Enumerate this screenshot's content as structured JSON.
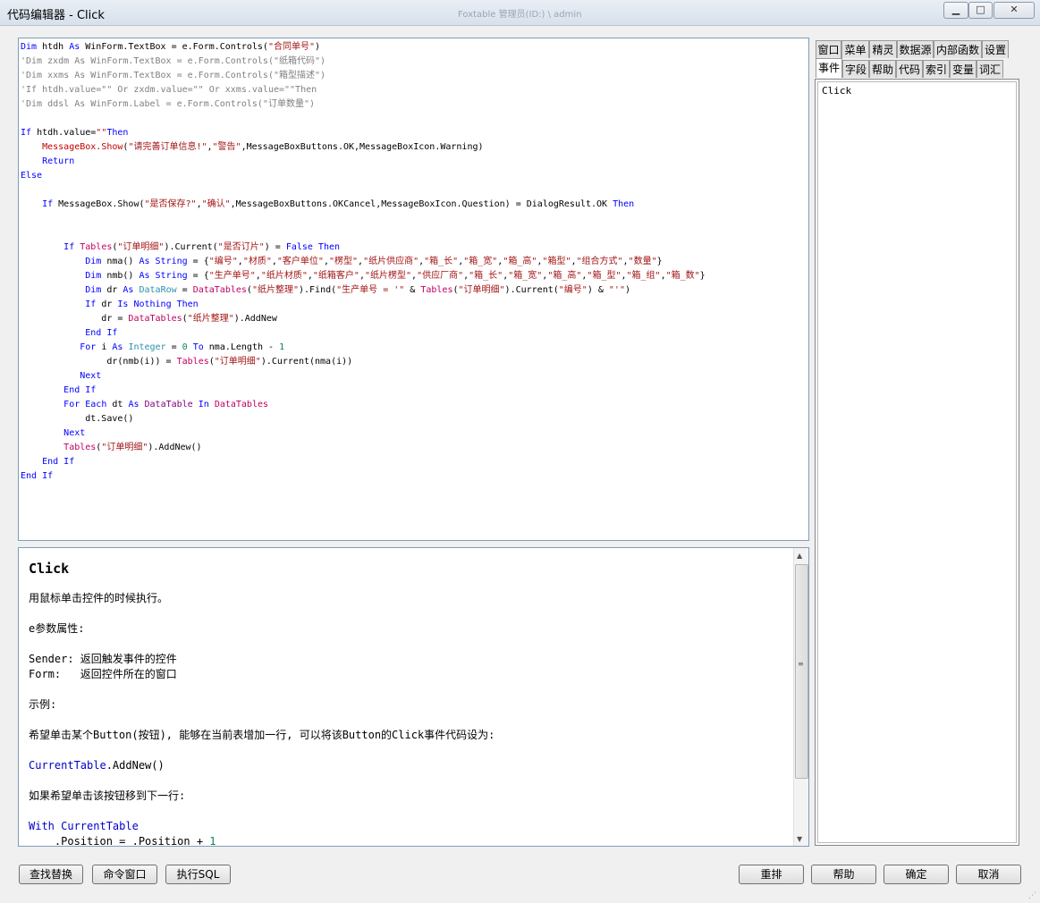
{
  "window": {
    "title": "代码编辑器 - Click",
    "faded_title": "Foxtable    管理员(ID:) \\ admin",
    "min_icon": "minimize-icon",
    "max_icon": "maximize-icon",
    "close_icon": "close-icon"
  },
  "code_lines": [
    [
      [
        "kw",
        "Dim"
      ],
      [
        "",
        " htdh "
      ],
      [
        "kw",
        "As"
      ],
      [
        "",
        " WinForm.TextBox = e.Form.Controls("
      ],
      [
        "str",
        "\"合同单号\""
      ],
      [
        "",
        ")"
      ]
    ],
    [
      [
        "cm",
        "'Dim zxdm As WinForm.TextBox = e.Form.Controls(\"纸箱代码\")"
      ]
    ],
    [
      [
        "cm",
        "'Dim xxms As WinForm.TextBox = e.Form.Controls(\"箱型描述\")"
      ]
    ],
    [
      [
        "cm",
        "'If htdh.value=\"\" Or zxdm.value=\"\" Or xxms.value=\"\"Then"
      ]
    ],
    [
      [
        "cm",
        "'Dim ddsl As WinForm.Label = e.Form.Controls(\"订单数量\")"
      ]
    ],
    [],
    [
      [
        "kw",
        "If"
      ],
      [
        "",
        " htdh.value="
      ],
      [
        "str",
        "\"\""
      ],
      [
        "kw",
        "Then"
      ]
    ],
    [
      [
        "",
        "    "
      ],
      [
        "fn",
        "MessageBox.Show"
      ],
      [
        "",
        "("
      ],
      [
        "str",
        "\"请完善订单信息!\""
      ],
      [
        "",
        ","
      ],
      [
        "str",
        "\"警告\""
      ],
      [
        "",
        ",MessageBoxButtons.OK,MessageBoxIcon.Warning)"
      ]
    ],
    [
      [
        "",
        "    "
      ],
      [
        "kw",
        "Return"
      ]
    ],
    [
      [
        "kw",
        "Else"
      ]
    ],
    [],
    [
      [
        "",
        "    "
      ],
      [
        "kw",
        "If"
      ],
      [
        "",
        " MessageBox.Show("
      ],
      [
        "str",
        "\"是否保存?\""
      ],
      [
        "",
        ","
      ],
      [
        "str",
        "\"确认\""
      ],
      [
        "",
        ",MessageBoxButtons.OKCancel,MessageBoxIcon.Question) = DialogResult.OK "
      ],
      [
        "kw",
        "Then"
      ]
    ],
    [],
    [],
    [
      [
        "",
        "        "
      ],
      [
        "kw",
        "If"
      ],
      [
        "",
        " "
      ],
      [
        "ob",
        "Tables"
      ],
      [
        "",
        "("
      ],
      [
        "str",
        "\"订单明细\""
      ],
      [
        "",
        ").Current("
      ],
      [
        "str",
        "\"是否订片\""
      ],
      [
        "",
        ") = "
      ],
      [
        "kw",
        "False Then"
      ]
    ],
    [
      [
        "",
        "            "
      ],
      [
        "kw",
        "Dim"
      ],
      [
        "",
        " nma() "
      ],
      [
        "kw",
        "As String"
      ],
      [
        "",
        " = {"
      ],
      [
        "str",
        "\"编号\""
      ],
      [
        "",
        ","
      ],
      [
        "str",
        "\"材质\""
      ],
      [
        "",
        ","
      ],
      [
        "str",
        "\"客户单位\""
      ],
      [
        "",
        ","
      ],
      [
        "str",
        "\"楞型\""
      ],
      [
        "",
        ","
      ],
      [
        "str",
        "\"纸片供应商\""
      ],
      [
        "",
        ","
      ],
      [
        "str",
        "\"箱_长\""
      ],
      [
        "",
        ","
      ],
      [
        "str",
        "\"箱_宽\""
      ],
      [
        "",
        ","
      ],
      [
        "str",
        "\"箱_高\""
      ],
      [
        "",
        ","
      ],
      [
        "str",
        "\"箱型\""
      ],
      [
        "",
        ","
      ],
      [
        "str",
        "\"组合方式\""
      ],
      [
        "",
        ","
      ],
      [
        "str",
        "\"数量\""
      ],
      [
        "",
        "}"
      ]
    ],
    [
      [
        "",
        "            "
      ],
      [
        "kw",
        "Dim"
      ],
      [
        "",
        " nmb() "
      ],
      [
        "kw",
        "As String"
      ],
      [
        "",
        " = {"
      ],
      [
        "str",
        "\"生产单号\""
      ],
      [
        "",
        ","
      ],
      [
        "str",
        "\"纸片材质\""
      ],
      [
        "",
        ","
      ],
      [
        "str",
        "\"纸箱客户\""
      ],
      [
        "",
        ","
      ],
      [
        "str",
        "\"纸片楞型\""
      ],
      [
        "",
        ","
      ],
      [
        "str",
        "\"供应厂商\""
      ],
      [
        "",
        ","
      ],
      [
        "str",
        "\"箱_长\""
      ],
      [
        "",
        ","
      ],
      [
        "str",
        "\"箱_宽\""
      ],
      [
        "",
        ","
      ],
      [
        "str",
        "\"箱_高\""
      ],
      [
        "",
        ","
      ],
      [
        "str",
        "\"箱_型\""
      ],
      [
        "",
        ","
      ],
      [
        "str",
        "\"箱_组\""
      ],
      [
        "",
        ","
      ],
      [
        "str",
        "\"箱_数\""
      ],
      [
        "",
        "}"
      ]
    ],
    [
      [
        "",
        "            "
      ],
      [
        "kw",
        "Dim"
      ],
      [
        "",
        " dr "
      ],
      [
        "kw",
        "As"
      ],
      [
        "",
        " "
      ],
      [
        "ty",
        "DataRow"
      ],
      [
        "",
        " = "
      ],
      [
        "ob",
        "DataTables"
      ],
      [
        "",
        "("
      ],
      [
        "str",
        "\"纸片整理\""
      ],
      [
        "",
        ").Find("
      ],
      [
        "str",
        "\"生产单号 = '\""
      ],
      [
        "",
        " & "
      ],
      [
        "ob",
        "Tables"
      ],
      [
        "",
        "("
      ],
      [
        "str",
        "\"订单明细\""
      ],
      [
        "",
        ").Current("
      ],
      [
        "str",
        "\"编号\""
      ],
      [
        "",
        ") & "
      ],
      [
        "str",
        "\"'\""
      ],
      [
        "",
        ")"
      ]
    ],
    [
      [
        "",
        "            "
      ],
      [
        "kw",
        "If"
      ],
      [
        "",
        " dr "
      ],
      [
        "kw",
        "Is Nothing Then"
      ]
    ],
    [
      [
        "",
        "               dr = "
      ],
      [
        "ob",
        "DataTables"
      ],
      [
        "",
        "("
      ],
      [
        "str",
        "\"纸片整理\""
      ],
      [
        "",
        ").AddNew"
      ]
    ],
    [
      [
        "",
        "            "
      ],
      [
        "kw",
        "End If"
      ]
    ],
    [
      [
        "",
        "           "
      ],
      [
        "kw",
        "For"
      ],
      [
        "",
        " i "
      ],
      [
        "kw",
        "As"
      ],
      [
        "",
        " "
      ],
      [
        "ty",
        "Integer"
      ],
      [
        "",
        " = "
      ],
      [
        "num",
        "0"
      ],
      [
        "",
        " "
      ],
      [
        "kw",
        "To"
      ],
      [
        "",
        " nma.Length - "
      ],
      [
        "num",
        "1"
      ]
    ],
    [
      [
        "",
        "                dr(nmb(i)) = "
      ],
      [
        "ob",
        "Tables"
      ],
      [
        "",
        "("
      ],
      [
        "str",
        "\"订单明细\""
      ],
      [
        "",
        ").Current(nma(i))"
      ]
    ],
    [
      [
        "",
        "           "
      ],
      [
        "kw",
        "Next"
      ]
    ],
    [
      [
        "",
        "        "
      ],
      [
        "kw",
        "End If"
      ]
    ],
    [
      [
        "",
        "        "
      ],
      [
        "kw",
        "For Each"
      ],
      [
        "",
        " dt "
      ],
      [
        "kw",
        "As"
      ],
      [
        "",
        " "
      ],
      [
        "pr",
        "DataTable"
      ],
      [
        "",
        " "
      ],
      [
        "kw",
        "In"
      ],
      [
        "",
        " "
      ],
      [
        "ob",
        "DataTables"
      ]
    ],
    [
      [
        "",
        "            dt.Save()"
      ]
    ],
    [
      [
        "",
        "        "
      ],
      [
        "kw",
        "Next"
      ]
    ],
    [
      [
        "",
        "        "
      ],
      [
        "ob",
        "Tables"
      ],
      [
        "",
        "("
      ],
      [
        "str",
        "\"订单明细\""
      ],
      [
        "",
        ").AddNew()"
      ]
    ],
    [
      [
        "",
        "    "
      ],
      [
        "kw",
        "End If"
      ]
    ],
    [
      [
        "kw",
        "End If"
      ]
    ]
  ],
  "help": {
    "title": "Click",
    "lines": [
      {
        "t": "用鼠标单击控件的时候执行。",
        "c": ""
      },
      {
        "t": "",
        "c": ""
      },
      {
        "t": "e参数属性:",
        "c": ""
      },
      {
        "t": "",
        "c": ""
      },
      {
        "t": "Sender: 返回触发事件的控件",
        "c": ""
      },
      {
        "t": "Form:   返回控件所在的窗口",
        "c": ""
      },
      {
        "t": "",
        "c": ""
      },
      {
        "t": "示例:",
        "c": ""
      },
      {
        "t": "",
        "c": ""
      },
      {
        "t": "希望单击某个Button(按钮), 能够在当前表增加一行, 可以将该Button的Click事件代码设为:",
        "c": ""
      },
      {
        "t": "",
        "c": ""
      },
      {
        "t": "CurrentTable",
        "c": "blue",
        "rest": ".AddNew()"
      },
      {
        "t": "",
        "c": ""
      },
      {
        "t": "如果希望单击该按钮移到下一行:",
        "c": ""
      },
      {
        "t": "",
        "c": ""
      },
      {
        "t": "With CurrentTable",
        "c": "blue"
      },
      {
        "t": "    .Position = .Position + ",
        "c": "",
        "num": "1"
      }
    ]
  },
  "right_tabs_row1": [
    "窗口",
    "菜单",
    "精灵",
    "数据源",
    "内部函数",
    "设置"
  ],
  "right_tabs_row2": [
    "事件",
    "字段",
    "帮助",
    "代码",
    "索引",
    "变量",
    "词汇"
  ],
  "event_list": [
    "Click"
  ],
  "buttons": {
    "find_replace": "查找替换",
    "command_window": "命令窗口",
    "exec_sql": "执行SQL",
    "rearrange": "重排",
    "help": "帮助",
    "ok": "确定",
    "cancel": "取消"
  }
}
